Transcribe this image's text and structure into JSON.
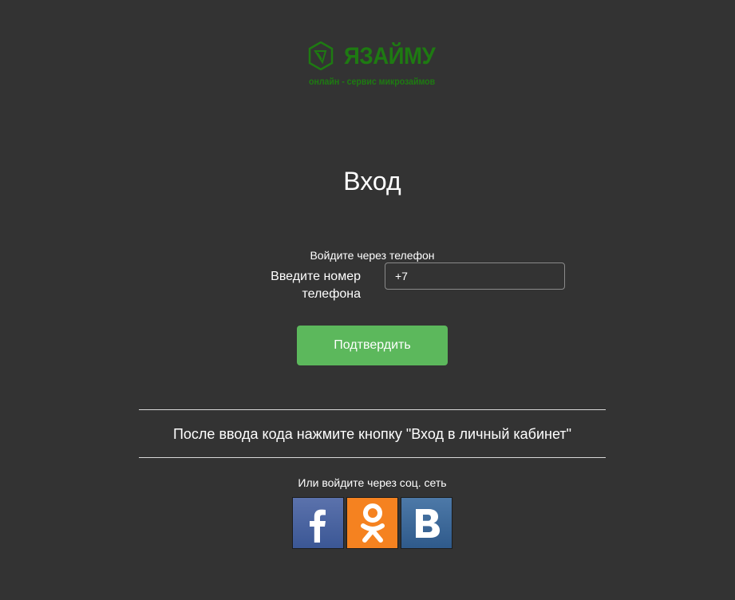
{
  "brand": {
    "name": "ЯЗАЙМУ",
    "tagline": "онлайн - сервис микрозаймов",
    "color": "#1e7a12"
  },
  "login": {
    "title": "Вход",
    "phone_hint": "Войдите через телефон",
    "phone_label": "Введите номер телефона",
    "phone_value": "+7",
    "confirm_label": "Подтвердить",
    "confirm_color": "#5cb85c"
  },
  "note": "После ввода кода нажмите кнопку \"Вход в личный кабинет\"",
  "social": {
    "hint": "Или войдите через соц. сеть",
    "networks": [
      {
        "name": "facebook",
        "icon": "facebook-icon",
        "color": "#3b5795"
      },
      {
        "name": "odnoklassniki",
        "icon": "odnoklassniki-icon",
        "color": "#f58220"
      },
      {
        "name": "vkontakte",
        "icon": "vk-icon",
        "color": "#2f5a8b"
      }
    ]
  }
}
